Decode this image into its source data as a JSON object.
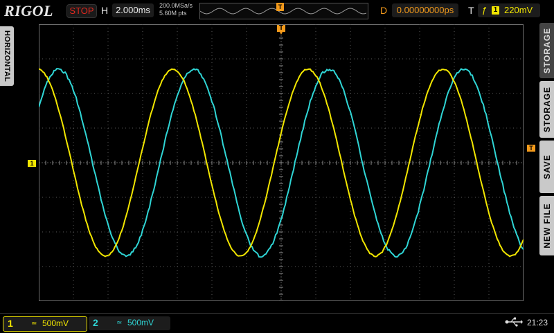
{
  "brand": "RIGOL",
  "run_status": "STOP",
  "horizontal": {
    "label": "H",
    "timebase": "2.000ms",
    "sample_rate": "200.0MSa/s",
    "memory_depth": "5.60M pts"
  },
  "delay": {
    "label": "D",
    "value": "0.00000000ps"
  },
  "trigger": {
    "label": "T",
    "source": "1",
    "level": "220mV",
    "marker": "T"
  },
  "left_tab": "HORIZONTAL",
  "right_menu": [
    "STORAGE",
    "STORAGE",
    "SAVE",
    "NEW FILE"
  ],
  "channels": [
    {
      "number": "1",
      "coupling_symbol": "≃",
      "scale": "500mV",
      "color": "#f2e600"
    },
    {
      "number": "2",
      "coupling_symbol": "≃",
      "scale": "500mV",
      "color": "#2fd5d5"
    }
  ],
  "ch1_ground_marker": "1",
  "clock": "21:23",
  "usb_icon": "usb-icon",
  "colors": {
    "ch1": "#f2e600",
    "ch2": "#2fd5d5",
    "trigger": "#f39a1b",
    "stop": "#e0281e"
  }
}
